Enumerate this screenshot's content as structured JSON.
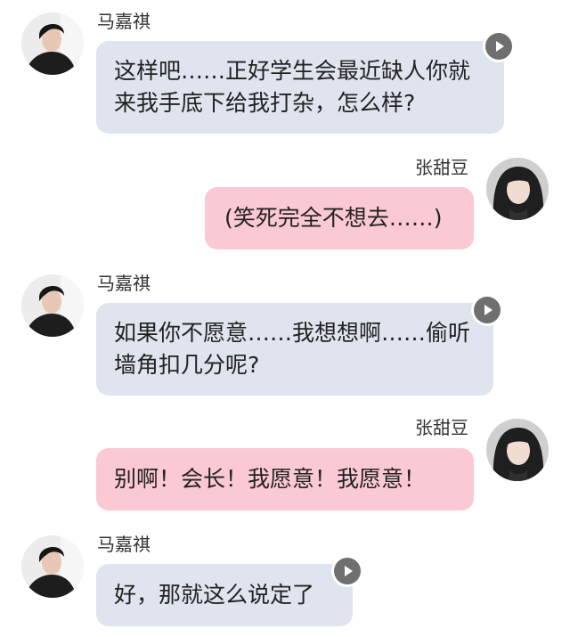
{
  "contacts": {
    "left": {
      "name": "马嘉祺"
    },
    "right": {
      "name": "张甜豆"
    }
  },
  "messages": [
    {
      "sender": "马嘉祺",
      "side": "left",
      "lines": [
        "这样吧……正好学生会最近缺人你就",
        "来我手底下给我打杂，怎么样?"
      ],
      "has_play_icon": true
    },
    {
      "sender": "张甜豆",
      "side": "right",
      "lines": [
        "(笑死完全不想去……)"
      ],
      "has_play_icon": false
    },
    {
      "sender": "马嘉祺",
      "side": "left",
      "lines": [
        "如果你不愿意……我想想啊……偷听",
        "墙角扣几分呢?"
      ],
      "has_play_icon": true
    },
    {
      "sender": "张甜豆",
      "side": "right",
      "lines": [
        "别啊！会长！我愿意！我愿意！"
      ],
      "has_play_icon": false
    },
    {
      "sender": "马嘉祺",
      "side": "left",
      "lines": [
        "好，那就这么说定了"
      ],
      "has_play_icon": true
    }
  ],
  "colors": {
    "left_bubble": "#dfe4ee",
    "right_bubble": "#fbc9d3",
    "play_icon": "#6f6f6f",
    "name_text": "#333333",
    "message_text": "#222222"
  },
  "icons": {
    "play": "play-icon",
    "left_avatar": "boy-avatar",
    "right_avatar": "girl-avatar"
  }
}
